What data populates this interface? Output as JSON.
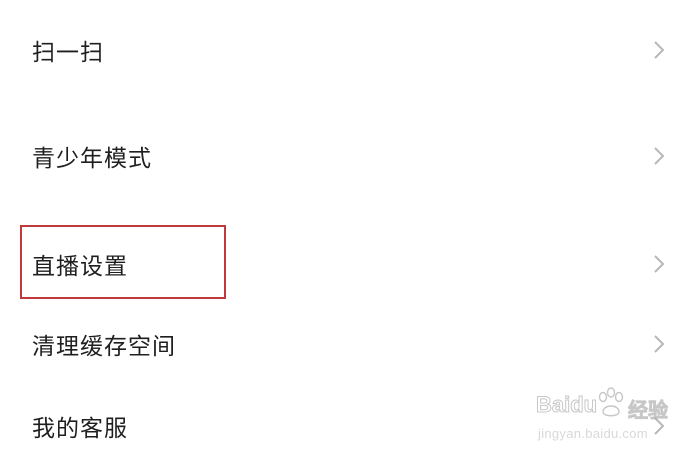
{
  "settings": {
    "items": [
      {
        "label": "扫一扫"
      },
      {
        "label": "青少年模式"
      },
      {
        "label": "直播设置"
      },
      {
        "label": "清理缓存空间"
      },
      {
        "label": "我的客服"
      }
    ]
  },
  "highlight": {
    "color": "#c0393b",
    "target": "直播设置"
  },
  "watermark": {
    "brand": "Baidu",
    "product": "经验",
    "url": "jingyan.baidu.com"
  },
  "icons": {
    "chevron": "chevron-right-icon",
    "watermark_logo": "baidu-paw-icon"
  }
}
